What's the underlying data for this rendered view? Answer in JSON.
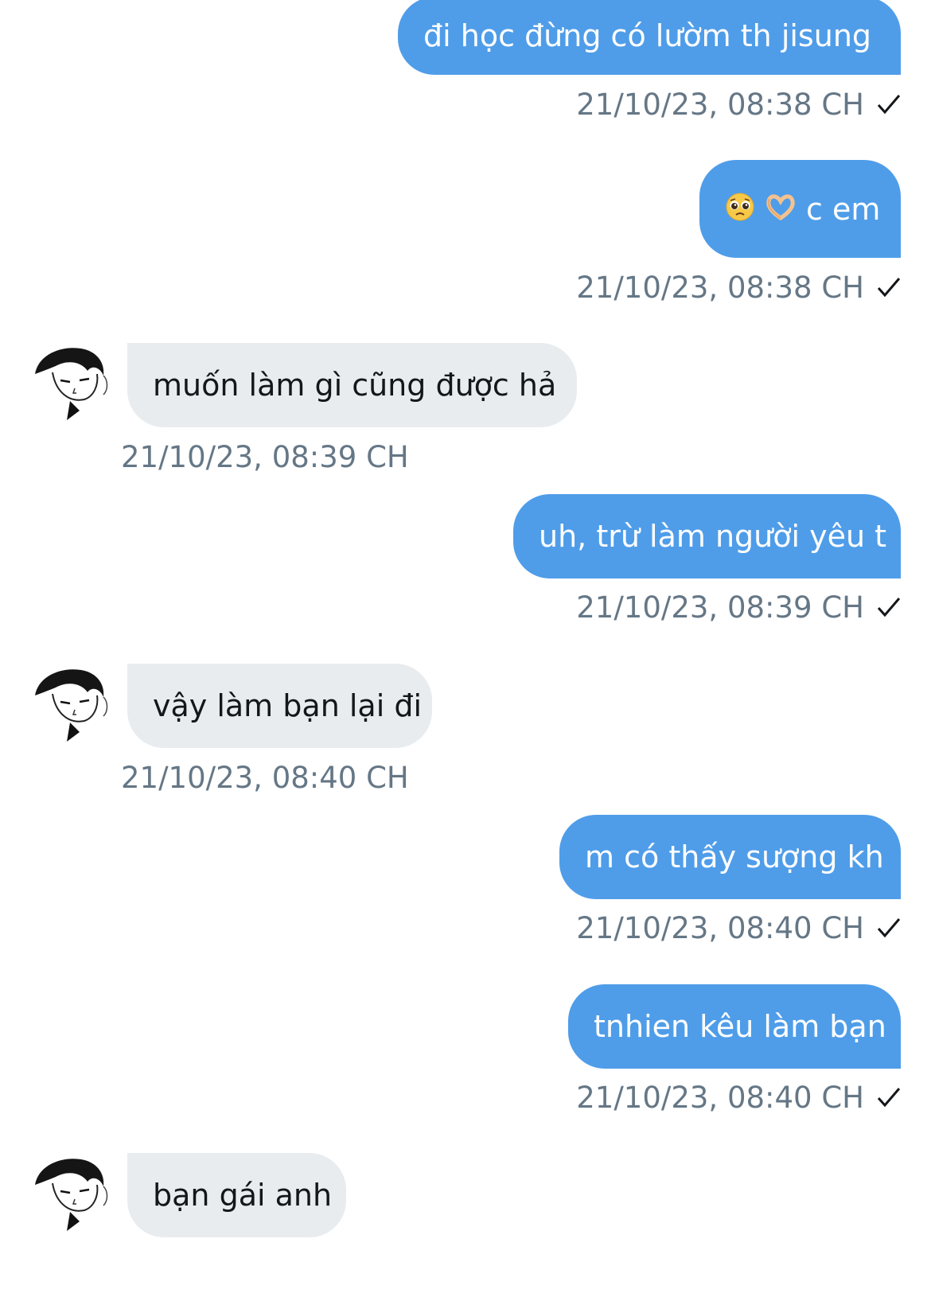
{
  "colors": {
    "outgoing_bubble": "#4f9de9",
    "incoming_bubble": "#e8ecef",
    "timestamp": "#657786"
  },
  "icons": {
    "read_receipt": "check-icon",
    "emoji_1": "pleading-face-emoji",
    "emoji_2": "heart-hands-emoji"
  },
  "messages": [
    {
      "direction": "outgoing",
      "text": "đi học đừng có lườm th jisung",
      "time": "21/10/23, 08:38 CH",
      "status": "✓"
    },
    {
      "direction": "outgoing",
      "text": "c em",
      "time": "21/10/23, 08:38 CH",
      "status": "✓"
    },
    {
      "direction": "incoming",
      "text": "muốn làm gì cũng được hả",
      "time": "21/10/23, 08:39 CH"
    },
    {
      "direction": "outgoing",
      "text": "uh, trừ làm người yêu t",
      "time": "21/10/23, 08:39 CH",
      "status": "✓"
    },
    {
      "direction": "incoming",
      "text": "vậy làm bạn lại đi",
      "time": "21/10/23, 08:40 CH"
    },
    {
      "direction": "outgoing",
      "text": "m có thấy sượng kh",
      "time": "21/10/23, 08:40 CH",
      "status": "✓"
    },
    {
      "direction": "outgoing",
      "text": "tnhien kêu làm bạn",
      "time": "21/10/23, 08:40 CH",
      "status": "✓"
    },
    {
      "direction": "incoming",
      "text": "bạn gái anh"
    }
  ]
}
